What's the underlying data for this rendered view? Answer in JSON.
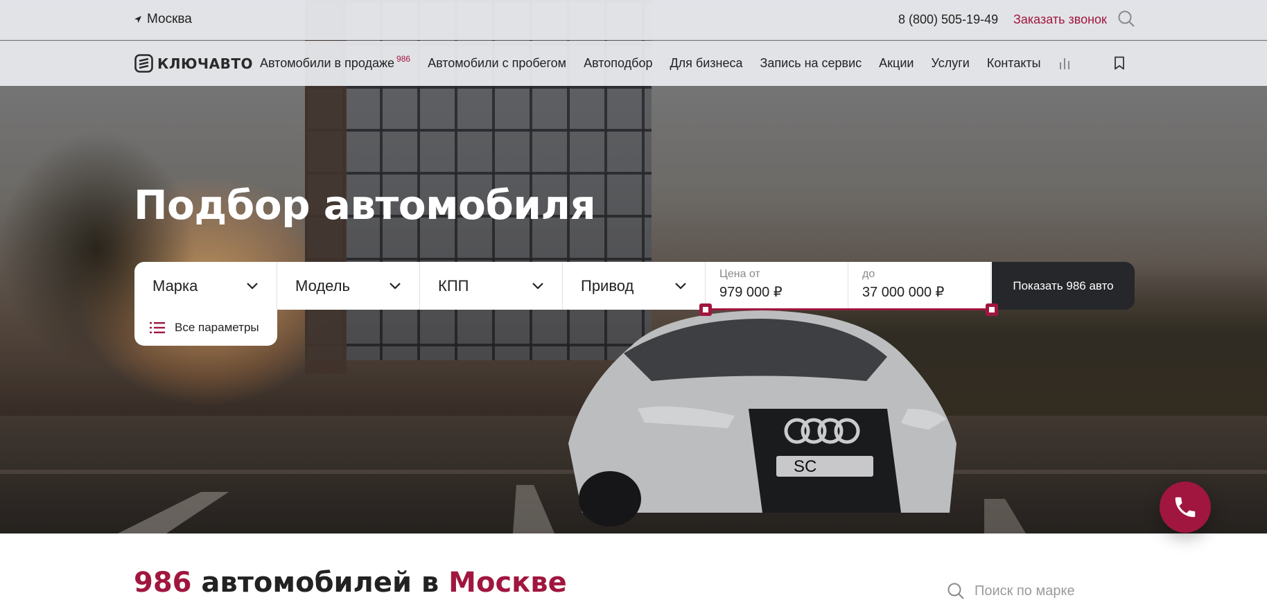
{
  "header": {
    "city": "Москва",
    "phone": "8 (800) 505-19-49",
    "callback_label": "Заказать звонок"
  },
  "nav": {
    "logo_text": "КЛЮЧАВТО",
    "items": [
      {
        "label": "Автомобили в продаже",
        "badge": "986"
      },
      {
        "label": "Автомобили с пробегом"
      },
      {
        "label": "Автоподбор"
      },
      {
        "label": "Для бизнеса"
      },
      {
        "label": "Запись на сервис"
      },
      {
        "label": "Акции"
      },
      {
        "label": "Услуги"
      },
      {
        "label": "Контакты"
      }
    ]
  },
  "hero": {
    "title": "Подбор автомобиля"
  },
  "filters": {
    "brand": "Марка",
    "model": "Модель",
    "gearbox": "КПП",
    "drive": "Привод",
    "price_from_label": "Цена от",
    "price_from_value": "979 000 ₽",
    "price_to_label": "до",
    "price_to_value": "37 000 000 ₽",
    "show_button": "Показать 986 авто",
    "all_params": "Все параметры"
  },
  "listing": {
    "count": "986",
    "title_middle": " автомобилей в ",
    "city": "Москве",
    "brand_search_placeholder": "Поиск по марке"
  },
  "colors": {
    "accent": "#a0163f",
    "dark_button": "#26272a",
    "header_bg": "#e8e9ed"
  },
  "icons": [
    "location-arrow-icon",
    "search-icon",
    "logo-icon",
    "chart-icon",
    "bookmark-icon",
    "chevron-down-icon",
    "list-icon",
    "phone-icon"
  ]
}
